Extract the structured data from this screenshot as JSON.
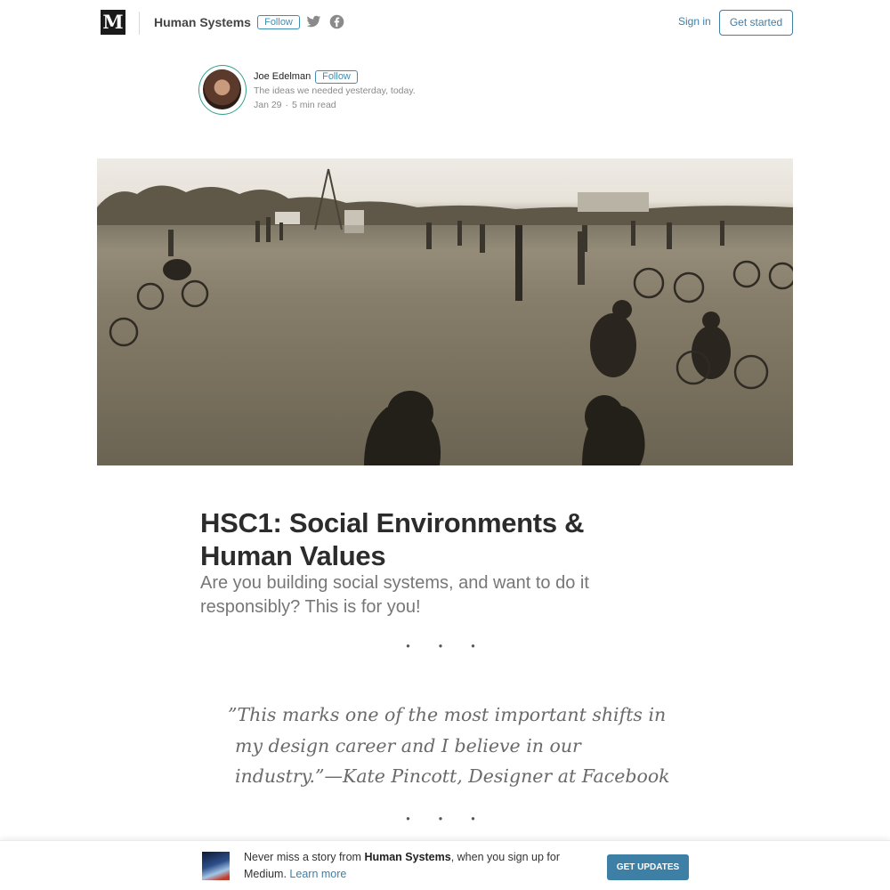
{
  "header": {
    "logo_text": "M",
    "publication_name": "Human Systems",
    "follow_label": "Follow",
    "social_icons": [
      "twitter-icon",
      "facebook-icon"
    ],
    "sign_in_label": "Sign in",
    "get_started_label": "Get started"
  },
  "author": {
    "name": "Joe Edelman",
    "follow_label": "Follow",
    "bio": "The ideas we needed yesterday, today.",
    "date": "Jan 29",
    "separator": "·",
    "read_time": "5 min read"
  },
  "article": {
    "title_line1": "HSC1: Social Environments &",
    "title_line2": "Human Values",
    "subtitle": "Are you building social systems, and want to do it responsibly? This is for you!",
    "section_break": "...",
    "quote": "”This marks one of the most important shifts in my design career and I believe in our industry.”—Kate Pincott, Designer at Facebook"
  },
  "banner": {
    "text_before": "Never miss a story from ",
    "publication": "Human Systems",
    "text_after": ", when you sign up for Medium.",
    "learn_more": "Learn more",
    "cta_label": "GET UPDATES"
  },
  "colors": {
    "accent": "#3e7fa6",
    "follow": "#3e8eb3",
    "avatar_ring": "#33a08a"
  }
}
